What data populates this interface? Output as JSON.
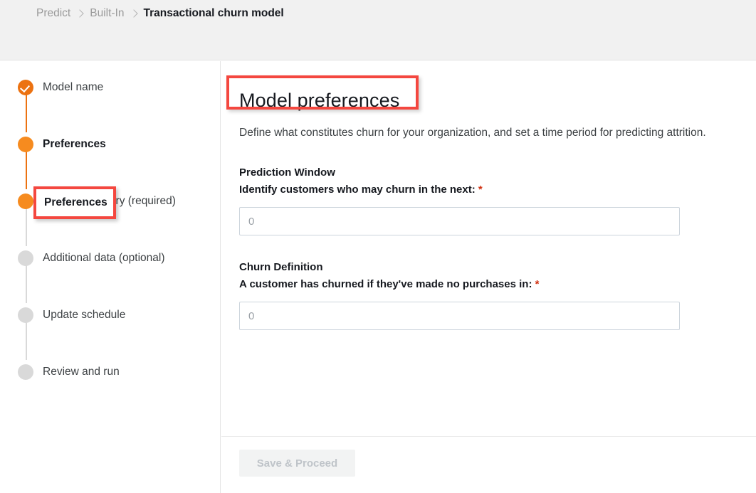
{
  "breadcrumb": {
    "items": [
      {
        "label": "Predict",
        "current": false
      },
      {
        "label": "Built-In",
        "current": false
      },
      {
        "label": "Transactional churn model",
        "current": true
      }
    ]
  },
  "sidebar": {
    "steps": [
      {
        "label": "Model name",
        "state": "done"
      },
      {
        "label": "Preferences",
        "state": "active"
      },
      {
        "label": "Purchase history (required)",
        "state": "active"
      },
      {
        "label": "Additional data (optional)",
        "state": "pending"
      },
      {
        "label": "Update schedule",
        "state": "pending"
      },
      {
        "label": "Review and run",
        "state": "pending"
      }
    ]
  },
  "main": {
    "title": "Model preferences",
    "description": "Define what constitutes churn for your organization, and set a time period for predicting attrition.",
    "fields": [
      {
        "heading": "Prediction Window",
        "sublabel": "Identify customers who may churn in the next:",
        "required_marker": "*",
        "value": "",
        "placeholder": "0"
      },
      {
        "heading": "Churn Definition",
        "sublabel": "A customer has churned if they've made no purchases in:",
        "required_marker": "*",
        "value": "",
        "placeholder": "0"
      }
    ]
  },
  "footer": {
    "save_label": "Save & Proceed",
    "save_disabled": true
  },
  "annotations": {
    "highlight_color": "#f4473f",
    "preferences_box_label": "Preferences",
    "title_box_label": "Model preferences"
  },
  "theme": {
    "accent_orange": "#ec7211",
    "active_orange": "#f68b1f",
    "pending_grey": "#d9d9d9",
    "required_red": "#d13212",
    "header_bg": "#f1f1f1"
  }
}
